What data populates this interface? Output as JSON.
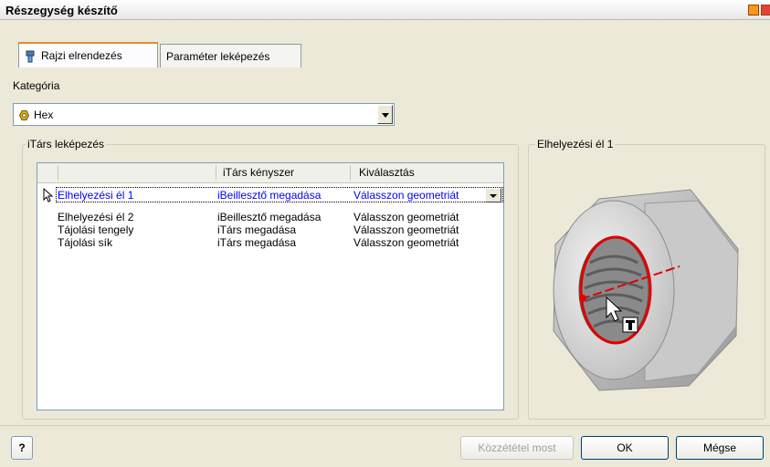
{
  "window": {
    "title": "Részegység készítő"
  },
  "tabs": [
    {
      "label": "Rajzi elrendezés",
      "active": true
    },
    {
      "label": "Paraméter leképezés",
      "active": false
    }
  ],
  "category": {
    "label": "Kategória",
    "value": "Hex",
    "icon": "hex-nut-icon"
  },
  "mapping": {
    "legend": "iTárs leképezés",
    "columns": [
      "",
      "iTárs kényszer",
      "Kiválasztás"
    ],
    "rows": [
      {
        "name": "Elhelyezési él 1",
        "constraint": "iBeillesztő megadása",
        "selection": "Válasszon geometriát",
        "selected": true
      },
      {
        "name": "Elhelyezési él 2",
        "constraint": "iBeillesztő megadása",
        "selection": "Válasszon geometriát",
        "selected": false
      },
      {
        "name": "Tájolási tengely",
        "constraint": "iTárs megadása",
        "selection": "Válasszon geometriát",
        "selected": false
      },
      {
        "name": "Tájolási sík",
        "constraint": "iTárs megadása",
        "selection": "Válasszon geometriát",
        "selected": false
      }
    ]
  },
  "preview": {
    "legend": "Elhelyezési él 1"
  },
  "buttons": {
    "help": "?",
    "publish": "Közzététel most",
    "ok": "OK",
    "cancel": "Mégse"
  },
  "colors": {
    "selected_row_text": "#0000ff",
    "highlight_ring": "#e00000",
    "tab_accent": "#e68b2c"
  }
}
